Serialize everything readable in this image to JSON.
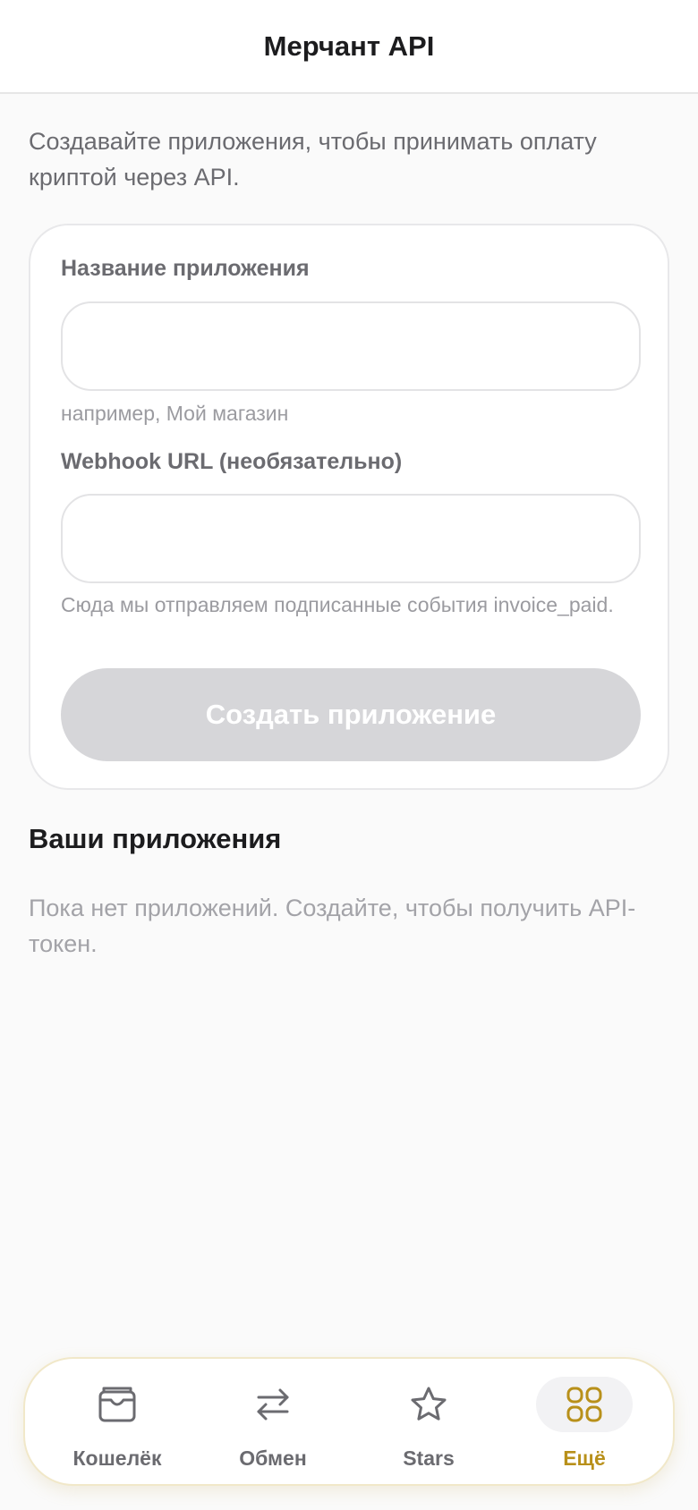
{
  "header": {
    "title": "Мерчант API"
  },
  "intro": "Создавайте приложения, чтобы принимать оплату криптой через API.",
  "form": {
    "name_label": "Название приложения",
    "name_value": "",
    "name_hint": "например, Мой магазин",
    "webhook_label": "Webhook URL (необязательно)",
    "webhook_value": "",
    "webhook_hint": "Сюда мы отправляем подписанные события invoice_paid.",
    "create_label": "Создать приложение"
  },
  "apps": {
    "title": "Ваши приложения",
    "empty_text": "Пока нет приложений. Создайте, чтобы получить API-токен."
  },
  "tabbar": {
    "items": [
      {
        "label": "Кошелёк",
        "icon": "wallet-icon",
        "active": false
      },
      {
        "label": "Обмен",
        "icon": "swap-icon",
        "active": false
      },
      {
        "label": "Stars",
        "icon": "star-icon",
        "active": false
      },
      {
        "label": "Ещё",
        "icon": "more-grid-icon",
        "active": true
      }
    ]
  },
  "colors": {
    "accent": "#b8901a",
    "button_disabled": "#d6d6d9",
    "background": "#fafafa"
  }
}
